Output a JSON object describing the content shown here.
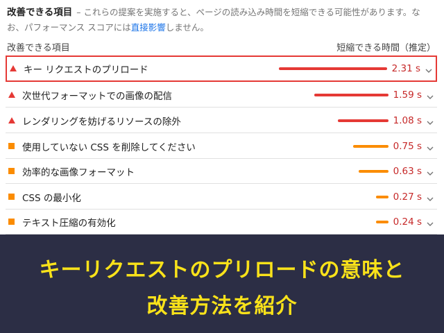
{
  "header": {
    "title": "改善できる項目",
    "dash": "–",
    "description_part1": "これらの提案を実施すると、ページの読み込み時間を短縮できる可能性があります。なお、パフォーマンス スコアには",
    "link_text": "直接影響",
    "description_part2": "しません。"
  },
  "columns": {
    "left": "改善できる項目",
    "right": "短縮できる時間（推定）"
  },
  "rows": [
    {
      "label": "キー リクエストのプリロード",
      "value": "2.31 s",
      "seconds": 2.31,
      "severity": "fail",
      "icon": "red-triangle-icon",
      "highlighted": true
    },
    {
      "label": "次世代フォーマットでの画像の配信",
      "value": "1.59 s",
      "seconds": 1.59,
      "severity": "fail",
      "icon": "red-triangle-icon",
      "highlighted": false
    },
    {
      "label": "レンダリングを妨げるリソースの除外",
      "value": "1.08 s",
      "seconds": 1.08,
      "severity": "fail",
      "icon": "red-triangle-icon",
      "highlighted": false
    },
    {
      "label": "使用していない CSS を削除してください",
      "value": "0.75 s",
      "seconds": 0.75,
      "severity": "average",
      "icon": "orange-square-icon",
      "highlighted": false
    },
    {
      "label": "効率的な画像フォーマット",
      "value": "0.63 s",
      "seconds": 0.63,
      "severity": "average",
      "icon": "orange-square-icon",
      "highlighted": false
    },
    {
      "label": "CSS の最小化",
      "value": "0.27 s",
      "seconds": 0.27,
      "severity": "average",
      "icon": "orange-square-icon",
      "highlighted": false
    },
    {
      "label": "テキスト圧縮の有効化",
      "value": "0.24 s",
      "seconds": 0.24,
      "severity": "average",
      "icon": "orange-square-icon",
      "highlighted": false
    }
  ],
  "banner": {
    "line1": "キーリクエストのプリロードの意味と",
    "line2": "改善方法を紹介"
  },
  "colors": {
    "fail": "#e53935",
    "average": "#fb8c00",
    "value_text": "#c62828",
    "link": "#1a73e8",
    "banner_bg": "#2c2e45",
    "banner_text": "#f9e21a"
  }
}
